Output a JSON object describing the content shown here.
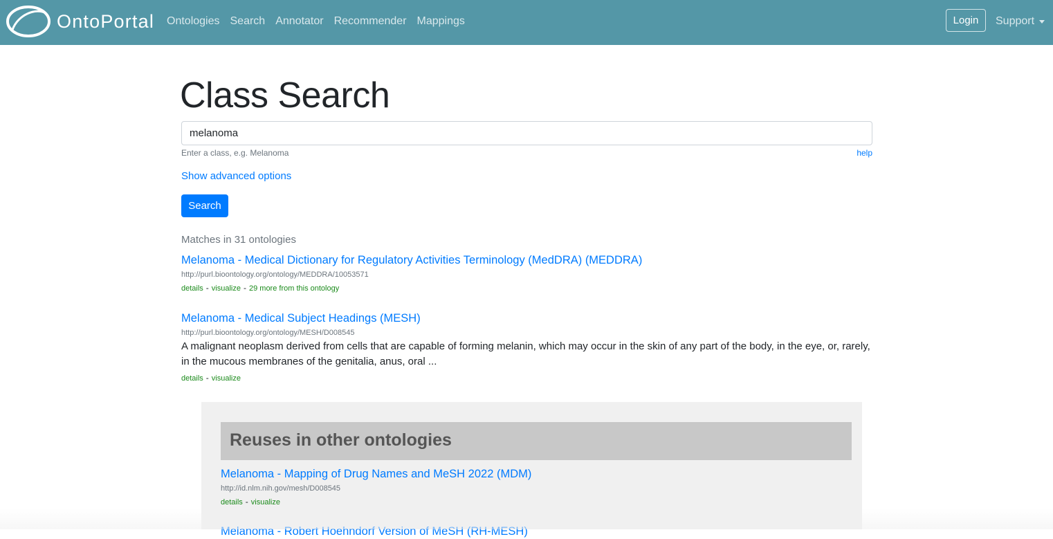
{
  "navbar": {
    "brand": "OntoPortal",
    "links": [
      "Ontologies",
      "Search",
      "Annotator",
      "Recommender",
      "Mappings"
    ],
    "login_label": "Login",
    "support_label": "Support",
    "background_color": "#5497a7"
  },
  "main": {
    "title": "Class Search",
    "search_value": "melanoma",
    "hint": "Enter a class, e.g. Melanoma",
    "help_label": "help",
    "advanced_label": "Show advanced options",
    "search_button_label": "Search",
    "matches_text": "Matches in 31 ontologies",
    "results": [
      {
        "title": "Melanoma - Medical Dictionary for Regulatory Activities Terminology (MedDRA) (MEDDRA)",
        "url": "http://purl.bioontology.org/ontology/MEDDRA/10053571",
        "details": "details",
        "visualize": "visualize",
        "more": "29 more from this ontology"
      },
      {
        "title": "Melanoma - Medical Subject Headings (MESH)",
        "url": "http://purl.bioontology.org/ontology/MESH/D008545",
        "description": "A malignant neoplasm derived from cells that are capable of forming melanin, which may occur in the skin of any part of the body, in the eye, or, rarely, in the mucous membranes of the genitalia, anus, oral ...",
        "details": "details",
        "visualize": "visualize"
      }
    ]
  },
  "reuses": {
    "header": "Reuses in other ontologies",
    "results": [
      {
        "title": "Melanoma - Mapping of Drug Names and MeSH 2022 (MDM)",
        "url": "http://id.nlm.nih.gov/mesh/D008545",
        "details": "details",
        "visualize": "visualize"
      },
      {
        "title": "Melanoma - Robert Hoehndorf Version of MeSH (RH-MESH)"
      }
    ]
  },
  "separator": "-"
}
